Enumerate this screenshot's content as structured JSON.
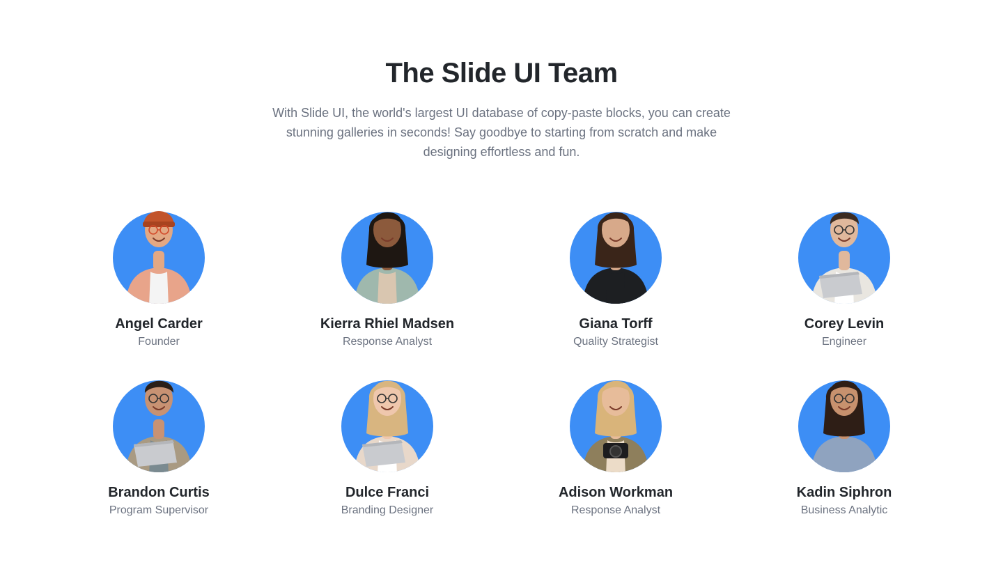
{
  "header": {
    "title": "The Slide UI Team",
    "subtitle": "With Slide UI, the world's largest UI database of copy-paste blocks, you can create stunning galleries in seconds! Say goodbye to starting from scratch and make designing effortless and fun."
  },
  "colors": {
    "avatar_bg": "#3d8ef5",
    "title": "#22262b",
    "muted": "#6b7280"
  },
  "team": [
    {
      "name": "Angel Carder",
      "role": "Founder",
      "skin": "#e3a883",
      "hair": "#c2542b",
      "top": "#e8a48a",
      "inner": "#f4f4f4",
      "accessory": "beanie"
    },
    {
      "name": "Kierra Rhiel Madsen",
      "role": "Response Analyst",
      "skin": "#8c5a3c",
      "hair": "#1e1712",
      "top": "#9fb8ad",
      "inner": "#d9c6b0",
      "accessory": "none"
    },
    {
      "name": "Giana Torff",
      "role": "Quality Strategist",
      "skin": "#d7a98a",
      "hair": "#3a2519",
      "top": "#1d1f22",
      "inner": "#1d1f22",
      "accessory": "none"
    },
    {
      "name": "Corey Levin",
      "role": "Engineer",
      "skin": "#e0b89c",
      "hair": "#3c2c22",
      "top": "#e9e6e0",
      "inner": "#ffffff",
      "accessory": "laptop"
    },
    {
      "name": "Brandon Curtis",
      "role": "Program Supervisor",
      "skin": "#c89273",
      "hair": "#2b1f18",
      "top": "#a99a82",
      "inner": "#7a8a90",
      "accessory": "laptop"
    },
    {
      "name": "Dulce Franci",
      "role": "Branding Designer",
      "skin": "#efc7ad",
      "hair": "#d8b580",
      "top": "#e8d8ca",
      "inner": "#ffffff",
      "accessory": "laptop"
    },
    {
      "name": "Adison Workman",
      "role": "Response Analyst",
      "skin": "#e7bc9a",
      "hair": "#d9b47a",
      "top": "#8e7f5c",
      "inner": "#ecdcc8",
      "accessory": "camera"
    },
    {
      "name": "Kadin Siphron",
      "role": "Business Analytic",
      "skin": "#c7916e",
      "hair": "#2e1e16",
      "top": "#8fa3bf",
      "inner": "#8fa3bf",
      "accessory": "glasses"
    }
  ]
}
